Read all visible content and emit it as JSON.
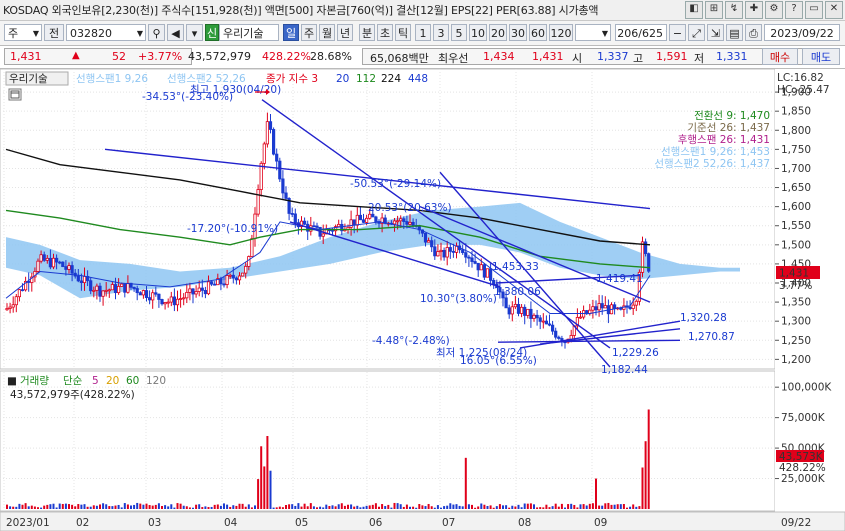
{
  "topbar": {
    "info": "KOSDAQ 외국인보유[2,230(천)] 주식수[151,928(천)] 액면[500] 자본금[760(억)] 결산[12월] EPS[22] PER[63.88] 시가총액",
    "buttons": [
      "◧",
      "⊞",
      "↯",
      "✚",
      "⚙",
      "?",
      "▭",
      "✕"
    ]
  },
  "toolbar": {
    "market": "주",
    "prev": "전",
    "code": "032820",
    "name_badge": "신",
    "name": "우리기술",
    "periods": [
      "일",
      "주",
      "월",
      "년",
      "분",
      "초",
      "틱"
    ],
    "active_period": "일",
    "intervals": [
      "1",
      "3",
      "5",
      "10",
      "20",
      "30",
      "60",
      "120"
    ],
    "count": "206",
    "total": "/625",
    "date": "2023/09/22",
    "buy": "매수",
    "sell": "매도"
  },
  "quote": {
    "price": "1,431",
    "arrow": "▲",
    "change": "52",
    "change_pct": "+3.77%",
    "volume": "43,572,979",
    "volume_pct": "428.22%",
    "turnover": "28.68%",
    "amount": "65,068백만",
    "best_bid_label": "최우선",
    "best_bid": "1,434",
    "best_ask": "1,431",
    "open_label": "시",
    "open": "1,337",
    "high_label": "고",
    "high": "1,591",
    "low_label": "저",
    "low": "1,331"
  },
  "legend_top": {
    "stock": "우리기술",
    "span1": "선행스팬1 9,26",
    "span2": "선행스팬2 52,26",
    "close_ma": "종가 지수 3",
    "ma20": "20",
    "ma112": "112",
    "ma224": "224",
    "ma448": "448",
    "lc": "LC:16.82",
    "hc": "HC:-25.47"
  },
  "ichimoku": {
    "tenkan": "전환선 9: 1,470",
    "kijun": "기준선 26: 1,437",
    "chikou": "후행스팬 26: 1,431",
    "span1": "선행스팬1 9,26: 1,453",
    "span2": "선행스팬2 52,26: 1,437"
  },
  "annotations": {
    "high": "최고 1,930(04/20)",
    "high_pct": "-34.53°(-23.40%)",
    "a1": "-50.53°(-29.14%)",
    "a2": "20.53°(20.63%)",
    "a3": "-17.20°(-10.91%)",
    "a4": "1,453.33",
    "a5": "1,380.06",
    "a6": "10.30°(3.80%)",
    "a7": "1,419.41",
    "a8": "1,320.28",
    "a9": "1,270.87",
    "a10": "-4.48°(-2.48%)",
    "low": "최저 1,225(08/24)",
    "low_pct": "16.05°(6.55%)",
    "a11": "1,229.26",
    "a12": "1,182.44"
  },
  "price_axis": {
    "ticks": [
      "1,900",
      "1,850",
      "1,800",
      "1,750",
      "1,700",
      "1,650",
      "1,600",
      "1,550",
      "1,500",
      "1,450",
      "1,400",
      "1,350",
      "1,300",
      "1,250",
      "1,200"
    ],
    "current": "1,431",
    "current_pct": "3.77%"
  },
  "volume_panel": {
    "legend_label": "거래량",
    "ma_label": "단순",
    "ma5": "5",
    "ma20": "20",
    "ma60": "60",
    "ma120": "120",
    "value": "43,572,979주(428.22%)",
    "ticks": [
      "100,000K",
      "75,000K",
      "50,000K",
      "25,000K"
    ],
    "current": "43,573K",
    "current_pct": "428.22%"
  },
  "x_axis": {
    "labels": [
      "2023/01",
      "02",
      "03",
      "04",
      "05",
      "06",
      "07",
      "08",
      "09"
    ],
    "right_label": "09/22"
  },
  "colors": {
    "up": "#e0001a",
    "down": "#1a3ad0",
    "cloud": "#8ec5f2",
    "ma_black": "#111111",
    "ma_green": "#1f8a1f",
    "trend": "#2222cc"
  },
  "chart_data": {
    "type": "candlestick",
    "ylim": [
      1180,
      1950
    ],
    "x": [
      "2023/01",
      "02",
      "03",
      "04",
      "05",
      "06",
      "07",
      "08",
      "09"
    ],
    "series": [
      {
        "name": "전환선 9",
        "values": [
          1470
        ]
      },
      {
        "name": "기준선 26",
        "values": [
          1437
        ]
      },
      {
        "name": "후행스팬 26",
        "values": [
          1431
        ]
      },
      {
        "name": "선행스팬1 9,26",
        "values": [
          1453
        ]
      },
      {
        "name": "선행스팬2 52,26",
        "values": [
          1437
        ]
      }
    ]
  }
}
